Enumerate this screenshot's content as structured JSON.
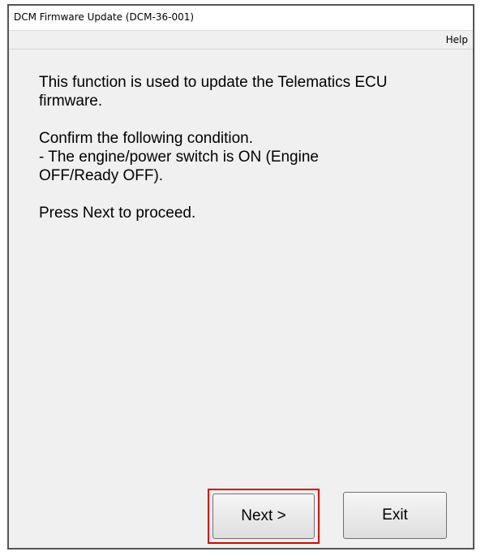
{
  "window": {
    "title": "DCM Firmware Update (DCM-36-001)"
  },
  "menu": {
    "help": "Help"
  },
  "content": {
    "paragraphs": [
      "This function is used to update the Telematics ECU\nfirmware.",
      "Confirm the following condition.\n- The engine/power switch is ON (Engine\nOFF/Ready OFF).",
      "Press Next to proceed."
    ]
  },
  "buttons": {
    "next": "Next >",
    "exit": "Exit"
  },
  "colors": {
    "highlight": "#e00000"
  }
}
